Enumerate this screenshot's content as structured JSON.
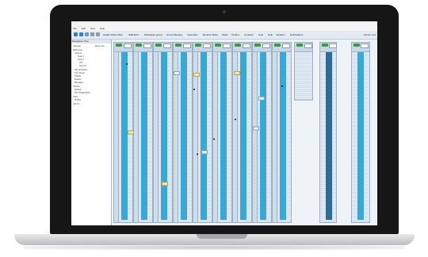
{
  "window": {
    "menu": [
      "File",
      "Edit",
      "View",
      "Help"
    ]
  },
  "toolbar": {
    "tabs": [
      "Health Visitor Plan",
      "Staff ECO",
      "Workplace group",
      "Group Meeting",
      "Calendars",
      "Routine Tasks",
      "Tasks",
      "Toolbox",
      "Contacts",
      "Help",
      "Help",
      "Vacation",
      "Notifications"
    ],
    "right_label": "Arbeid med"
  },
  "sidebar": {
    "header": "Navigation Tree",
    "items": [
      "Calendar",
      "Week view",
      "Staff group",
      "Group A",
      "Team 1",
      "Team 2",
      "Unit",
      "Sub unit",
      "Day Schedules",
      "Time Sheets",
      "Holiday",
      "Reports",
      "Messages",
      "Settings",
      "Settings",
      "Time Registrations",
      "Users",
      "Profiles",
      "Log out"
    ]
  },
  "colors": {
    "bar": "#38a9d6",
    "bar_dark": "#2a6d9d",
    "header_green": "#3e9a3c",
    "grid": "#dbe8f3"
  }
}
